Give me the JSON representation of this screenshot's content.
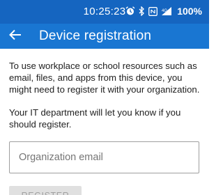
{
  "status_bar": {
    "time": "10:25:23",
    "battery": "100%",
    "icons": [
      "alarm-icon",
      "bluetooth-icon",
      "nfc-icon",
      "signal-icon"
    ]
  },
  "app_bar": {
    "title": "Device registration",
    "back_icon": "arrow-back-icon"
  },
  "content": {
    "paragraph_1": "To use workplace or school resources such as email, files, and apps from this device, you might need to register it with your organization.",
    "paragraph_2": "Your IT department will let you know if you should register."
  },
  "form": {
    "email_placeholder": "Organization email",
    "email_value": "",
    "register_label": "REGISTER",
    "register_enabled": false
  },
  "colors": {
    "status_bar": "#1565c0",
    "app_bar": "#1976d2",
    "text": "#212121",
    "button_disabled_bg": "#e0e0e0",
    "button_disabled_text": "#a0a0a0"
  }
}
